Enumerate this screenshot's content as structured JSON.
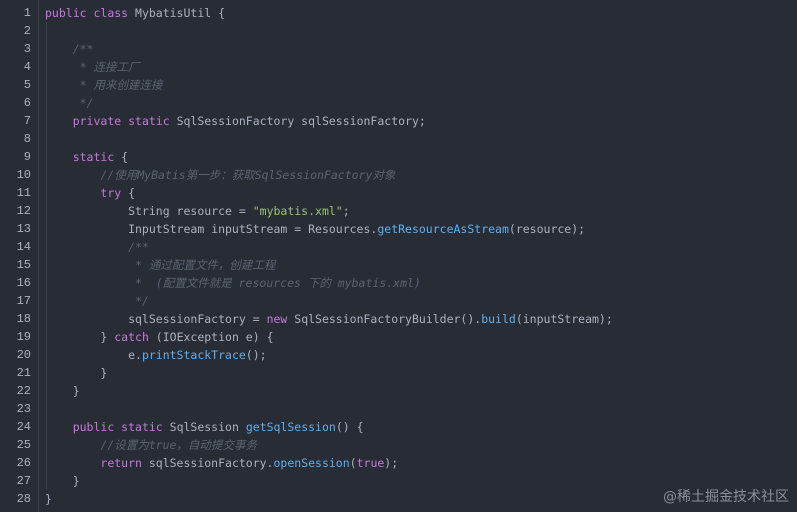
{
  "editor": {
    "lines": [
      {
        "n": "1",
        "segs": [
          [
            "kw",
            "public "
          ],
          [
            "kw",
            "class "
          ],
          [
            "ty",
            "MybatisUtil "
          ],
          [
            "pl",
            "{"
          ]
        ]
      },
      {
        "n": "2",
        "segs": []
      },
      {
        "n": "3",
        "segs": [
          [
            "cm",
            "    /**"
          ]
        ]
      },
      {
        "n": "4",
        "segs": [
          [
            "cm",
            "     * 连接工厂"
          ]
        ]
      },
      {
        "n": "5",
        "segs": [
          [
            "cm",
            "     * 用来创建连接"
          ]
        ]
      },
      {
        "n": "6",
        "segs": [
          [
            "cm",
            "     */"
          ]
        ]
      },
      {
        "n": "7",
        "segs": [
          [
            "pl",
            "    "
          ],
          [
            "kw",
            "private "
          ],
          [
            "kw",
            "static "
          ],
          [
            "ty",
            "SqlSessionFactory sqlSessionFactory;"
          ]
        ]
      },
      {
        "n": "8",
        "segs": []
      },
      {
        "n": "9",
        "segs": [
          [
            "pl",
            "    "
          ],
          [
            "kw",
            "static "
          ],
          [
            "pl",
            "{"
          ]
        ]
      },
      {
        "n": "10",
        "segs": [
          [
            "cm",
            "        //使用MyBatis第一步：获取SqlSessionFactory对象"
          ]
        ]
      },
      {
        "n": "11",
        "segs": [
          [
            "pl",
            "        "
          ],
          [
            "kw",
            "try "
          ],
          [
            "pl",
            "{"
          ]
        ]
      },
      {
        "n": "12",
        "segs": [
          [
            "pl",
            "            String resource = "
          ],
          [
            "str",
            "\"mybatis.xml\""
          ],
          [
            "pl",
            ";"
          ]
        ]
      },
      {
        "n": "13",
        "segs": [
          [
            "pl",
            "            InputStream inputStream = Resources."
          ],
          [
            "fn",
            "getResourceAsStream"
          ],
          [
            "pl",
            "(resource);"
          ]
        ]
      },
      {
        "n": "14",
        "segs": [
          [
            "cm",
            "            /**"
          ]
        ]
      },
      {
        "n": "15",
        "segs": [
          [
            "cm",
            "             * 通过配置文件，创建工程"
          ]
        ]
      },
      {
        "n": "16",
        "segs": [
          [
            "cm",
            "             *  (配置文件就是 resources 下的 mybatis.xml)"
          ]
        ]
      },
      {
        "n": "17",
        "segs": [
          [
            "cm",
            "             */"
          ]
        ]
      },
      {
        "n": "18",
        "segs": [
          [
            "pl",
            "            sqlSessionFactory = "
          ],
          [
            "kw",
            "new "
          ],
          [
            "pl",
            "SqlSessionFactoryBuilder()."
          ],
          [
            "fn",
            "build"
          ],
          [
            "pl",
            "(inputStream);"
          ]
        ]
      },
      {
        "n": "19",
        "segs": [
          [
            "pl",
            "        } "
          ],
          [
            "kw",
            "catch "
          ],
          [
            "pl",
            "(IOException e) {"
          ]
        ]
      },
      {
        "n": "20",
        "segs": [
          [
            "pl",
            "            e."
          ],
          [
            "fn",
            "printStackTrace"
          ],
          [
            "pl",
            "();"
          ]
        ]
      },
      {
        "n": "21",
        "segs": [
          [
            "pl",
            "        }"
          ]
        ]
      },
      {
        "n": "22",
        "segs": [
          [
            "pl",
            "    }"
          ]
        ]
      },
      {
        "n": "23",
        "segs": []
      },
      {
        "n": "24",
        "segs": [
          [
            "pl",
            "    "
          ],
          [
            "kw",
            "public "
          ],
          [
            "kw",
            "static "
          ],
          [
            "pl",
            "SqlSession "
          ],
          [
            "fn",
            "getSqlSession"
          ],
          [
            "pl",
            "() {"
          ]
        ]
      },
      {
        "n": "25",
        "segs": [
          [
            "cm",
            "        //设置为true，自动提交事务"
          ]
        ]
      },
      {
        "n": "26",
        "segs": [
          [
            "pl",
            "        "
          ],
          [
            "kw",
            "return "
          ],
          [
            "pl",
            "sqlSessionFactory."
          ],
          [
            "fn",
            "openSession"
          ],
          [
            "pl",
            "("
          ],
          [
            "kw",
            "true"
          ],
          [
            "pl",
            ");"
          ]
        ]
      },
      {
        "n": "27",
        "segs": [
          [
            "pl",
            "    }"
          ]
        ]
      },
      {
        "n": "28",
        "segs": [
          [
            "pl",
            "}"
          ]
        ]
      }
    ]
  },
  "watermark": "@稀土掘金技术社区",
  "colors": {
    "background": "#282c34",
    "keyword": "#c678dd",
    "string": "#98c379",
    "function": "#61afef",
    "comment": "#5c6370",
    "plain": "#abb2bf"
  }
}
